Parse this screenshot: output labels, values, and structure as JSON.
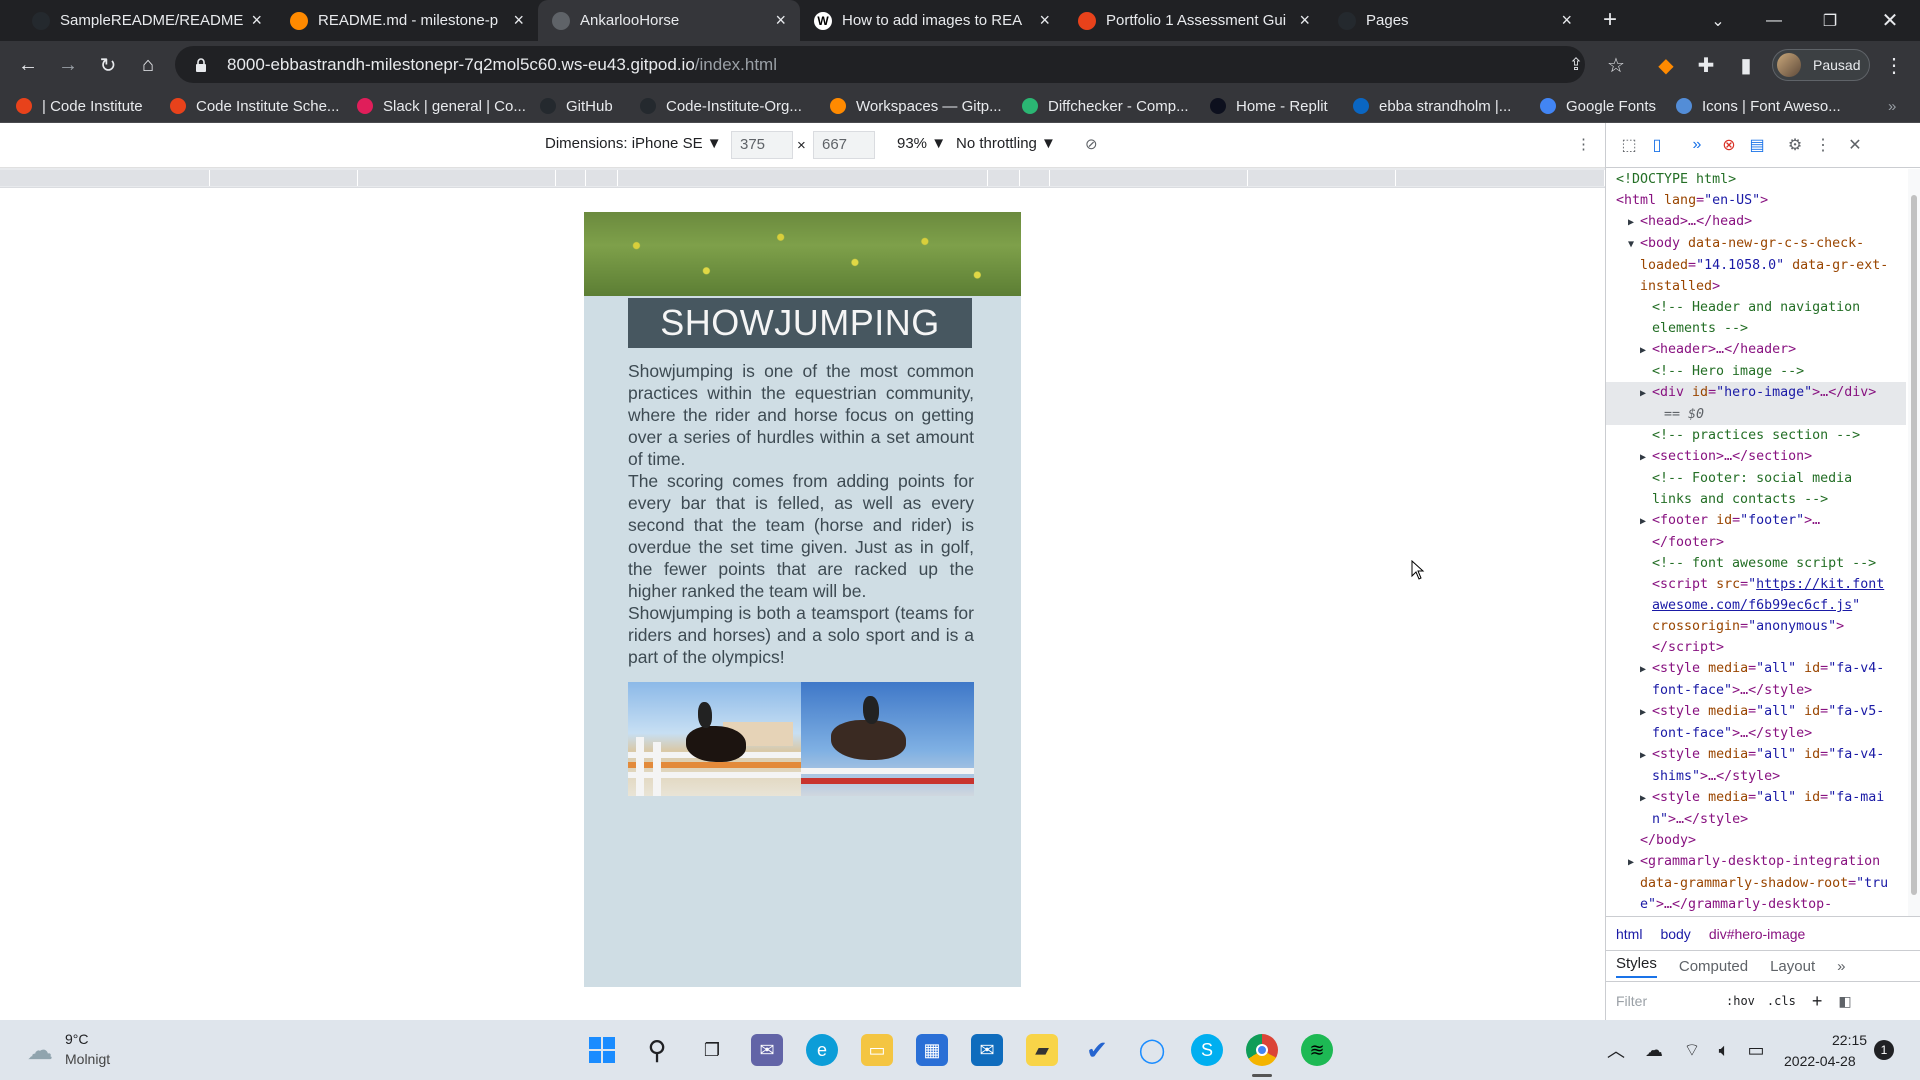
{
  "browser": {
    "tabs": [
      {
        "title": "SampleREADME/README.r",
        "icon": "github-icon",
        "color": "#24292e"
      },
      {
        "title": "README.md - milestone-p",
        "icon": "gitpod-icon",
        "color": "#ff8a00"
      },
      {
        "title": "AnkarlooHorse",
        "icon": "globe-icon",
        "color": "#5f6368",
        "active": true
      },
      {
        "title": "How to add images to REA",
        "icon": "wikipedia-icon",
        "color": "#ffffff"
      },
      {
        "title": "Portfolio 1 Assessment Gui",
        "icon": "codeinstitute-icon",
        "color": "#e8421b"
      },
      {
        "title": "Pages",
        "icon": "github-icon",
        "color": "#24292e"
      }
    ],
    "new_tab_label": "+",
    "url_host": "8000-ebbastrandh-milestonepr-7q2mol5c60.ws-eu43.gitpod.io",
    "url_path": "/index.html",
    "profile_label": "Pausad",
    "bookmarks": [
      {
        "label": "| Code Institute",
        "color": "#e8421b"
      },
      {
        "label": "Code Institute Sche...",
        "color": "#e8421b"
      },
      {
        "label": "Slack | general | Co...",
        "color": "#e01e5a"
      },
      {
        "label": "GitHub",
        "color": "#24292e"
      },
      {
        "label": "Code-Institute-Org...",
        "color": "#24292e"
      },
      {
        "label": "Workspaces — Gitp...",
        "color": "#ff8a00"
      },
      {
        "label": "Diffchecker - Comp...",
        "color": "#2bb673"
      },
      {
        "label": "Home - Replit",
        "color": "#0d101e"
      },
      {
        "label": "ebba strandholm |...",
        "color": "#0a66c2"
      },
      {
        "label": "Google Fonts",
        "color": "#4285f4"
      },
      {
        "label": "Icons | Font Aweso...",
        "color": "#538dd7"
      }
    ]
  },
  "device_toolbar": {
    "dimensions_label": "Dimensions: iPhone SE ▼",
    "width": "375",
    "times": "×",
    "height": "667",
    "zoom": "93% ▼",
    "throttling": "No throttling ▼"
  },
  "mobile_page": {
    "title": "SHOWJUMPING",
    "paragraphs": [
      "Showjumping is one of the most common practices within the equestrian community, where the rider and horse focus on getting over a series of hurdles within a set amount of time.",
      "The scoring comes from adding points for every bar that is felled, as well as every second that the team (horse and rider) is overdue the set time given. Just as in golf, the fewer points that are racked up the higher ranked the team will be.",
      "Showjumping is both a teamsport (teams for riders and horses) and a solo sport and is a part of the olympics!"
    ]
  },
  "devtools": {
    "dom_lines": [
      {
        "html": "<span class='cm'>&lt;!DOCTYPE html&gt;</span>",
        "indent": 1
      },
      {
        "html": "<span class='tg'>&lt;html</span> <span class='an'>lang</span>=<span class='av'>\"en-US\"</span><span class='tg'>&gt;</span>",
        "indent": 1
      },
      {
        "html": "<span class='tri'>▶</span><span class='tg'>&lt;head&gt;</span>…<span class='tg'>&lt;/head&gt;</span>",
        "indent": 2
      },
      {
        "html": "<span class='tri'>▼</span><span class='tg'>&lt;body</span> <span class='an'>data-new-gr-c-s-check-</span>",
        "indent": 2
      },
      {
        "html": "<span class='an'>loaded</span>=<span class='av'>\"14.1058.0\"</span> <span class='an'>data-gr-ext-</span>",
        "indent": 3
      },
      {
        "html": "<span class='an'>installed</span><span class='tg'>&gt;</span>",
        "indent": 3
      },
      {
        "html": "<span class='cm'>&lt;!-- Header and navigation</span>",
        "indent": 4
      },
      {
        "html": "<span class='cm'>elements --&gt;</span>",
        "indent": 4
      },
      {
        "html": "<span class='tri'>▶</span><span class='tg'>&lt;header&gt;</span>…<span class='tg'>&lt;/header&gt;</span>",
        "indent": 3
      },
      {
        "html": "<span class='cm'>&lt;!-- Hero image --&gt;</span>",
        "indent": 4
      },
      {
        "html": "<span class='tri'>▶</span><span class='tg'>&lt;div</span> <span class='an'>id</span>=<span class='av'>\"hero-image\"</span><span class='tg'>&gt;</span>…<span class='tg'>&lt;/div&gt;</span>",
        "indent": 3,
        "selected": true
      },
      {
        "html": "<span style='color:#5f6368;font-style:italic'>== $0</span>",
        "indent": 5,
        "selected": true
      },
      {
        "html": "<span class='cm'>&lt;!-- practices section --&gt;</span>",
        "indent": 4
      },
      {
        "html": "<span class='tri'>▶</span><span class='tg'>&lt;section&gt;</span>…<span class='tg'>&lt;/section&gt;</span>",
        "indent": 3
      },
      {
        "html": "<span class='cm'>&lt;!-- Footer: social media</span>",
        "indent": 4
      },
      {
        "html": "<span class='cm'>links and contacts --&gt;</span>",
        "indent": 4
      },
      {
        "html": "<span class='tri'>▶</span><span class='tg'>&lt;footer</span> <span class='an'>id</span>=<span class='av'>\"footer\"</span><span class='tg'>&gt;</span>…",
        "indent": 3
      },
      {
        "html": "<span class='tg'>&lt;/footer&gt;</span>",
        "indent": 4
      },
      {
        "html": "<span class='cm'>&lt;!-- font awesome script --&gt;</span>",
        "indent": 4
      },
      {
        "html": "<span class='tg'>&lt;script</span> <span class='an'>src</span>=<span class='av'>\"</span><span class='lk'>https://kit.font</span>",
        "indent": 4
      },
      {
        "html": "<span class='lk'>awesome.com/f6b99ec6cf.js</span><span class='av'>\"</span>",
        "indent": 4
      },
      {
        "html": "<span class='an'>crossorigin</span>=<span class='av'>\"anonymous\"</span><span class='tg'>&gt;</span>",
        "indent": 4
      },
      {
        "html": "<span class='tg'>&lt;/script&gt;</span>",
        "indent": 4
      },
      {
        "html": "<span class='tri'>▶</span><span class='tg'>&lt;style</span> <span class='an'>media</span>=<span class='av'>\"all\"</span> <span class='an'>id</span>=<span class='av'>\"fa-v4-</span>",
        "indent": 3
      },
      {
        "html": "<span class='av'>font-face\"</span><span class='tg'>&gt;</span>…<span class='tg'>&lt;/style&gt;</span>",
        "indent": 4
      },
      {
        "html": "<span class='tri'>▶</span><span class='tg'>&lt;style</span> <span class='an'>media</span>=<span class='av'>\"all\"</span> <span class='an'>id</span>=<span class='av'>\"fa-v5-</span>",
        "indent": 3
      },
      {
        "html": "<span class='av'>font-face\"</span><span class='tg'>&gt;</span>…<span class='tg'>&lt;/style&gt;</span>",
        "indent": 4
      },
      {
        "html": "<span class='tri'>▶</span><span class='tg'>&lt;style</span> <span class='an'>media</span>=<span class='av'>\"all\"</span> <span class='an'>id</span>=<span class='av'>\"fa-v4-</span>",
        "indent": 3
      },
      {
        "html": "<span class='av'>shims\"</span><span class='tg'>&gt;</span>…<span class='tg'>&lt;/style&gt;</span>",
        "indent": 4
      },
      {
        "html": "<span class='tri'>▶</span><span class='tg'>&lt;style</span> <span class='an'>media</span>=<span class='av'>\"all\"</span> <span class='an'>id</span>=<span class='av'>\"fa-mai</span>",
        "indent": 3
      },
      {
        "html": "<span class='av'>n\"</span><span class='tg'>&gt;</span>…<span class='tg'>&lt;/style&gt;</span>",
        "indent": 4
      },
      {
        "html": "<span class='tg'>&lt;/body&gt;</span>",
        "indent": 3
      },
      {
        "html": "<span class='tri'>▶</span><span class='tg'>&lt;grammarly-desktop-integration</span>",
        "indent": 2
      },
      {
        "html": "<span class='an'>data-grammarly-shadow-root</span>=<span class='av'>\"tru</span>",
        "indent": 3
      },
      {
        "html": "<span class='av'>e\"</span><span class='tg'>&gt;</span>…<span class='tg'>&lt;/grammarly-desktop-</span>",
        "indent": 3
      },
      {
        "html": "<span class='tg'>integration&gt;</span>",
        "indent": 3
      }
    ],
    "breadcrumbs": [
      "html",
      "body",
      "div#hero-image"
    ],
    "style_tabs": [
      "Styles",
      "Computed",
      "Layout",
      "»"
    ],
    "filter_placeholder": "Filter",
    "hov_label": ":hov",
    "cls_label": ".cls",
    "plus_label": "+"
  },
  "taskbar": {
    "temperature": "9°C",
    "weather": "Molnigt",
    "time": "22:15",
    "date": "2022-04-28",
    "notification_count": "1"
  }
}
